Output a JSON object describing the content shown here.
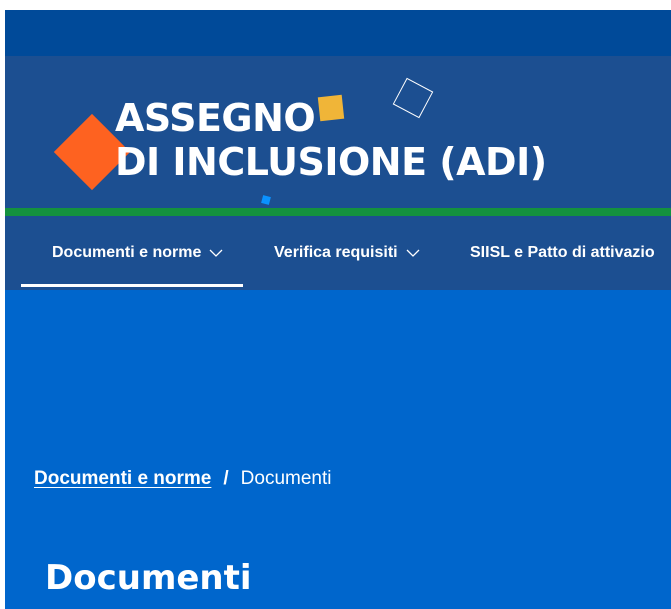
{
  "logo": {
    "line1": "ASSEGNO",
    "line2": "DI INCLUSIONE (ADI)"
  },
  "nav": {
    "items": [
      {
        "label": "Documenti e norme",
        "has_dropdown": true,
        "active": true
      },
      {
        "label": "Verifica requisiti",
        "has_dropdown": true,
        "active": false
      },
      {
        "label": "SIISL e Patto di attivazio",
        "has_dropdown": false,
        "active": false
      }
    ]
  },
  "breadcrumb": {
    "parent": "Documenti e norme",
    "separator": "/",
    "current": "Documenti"
  },
  "page": {
    "title": "Documenti"
  },
  "colors": {
    "topbar": "#004a99",
    "header": "#1c4f91",
    "accent_green": "#14923f",
    "hero": "#0066cc",
    "logo_orange": "#fe6220",
    "logo_yellow": "#f0b538",
    "logo_blue": "#0a92ff"
  },
  "icons": {
    "dropdown": "chevron-down-icon"
  }
}
